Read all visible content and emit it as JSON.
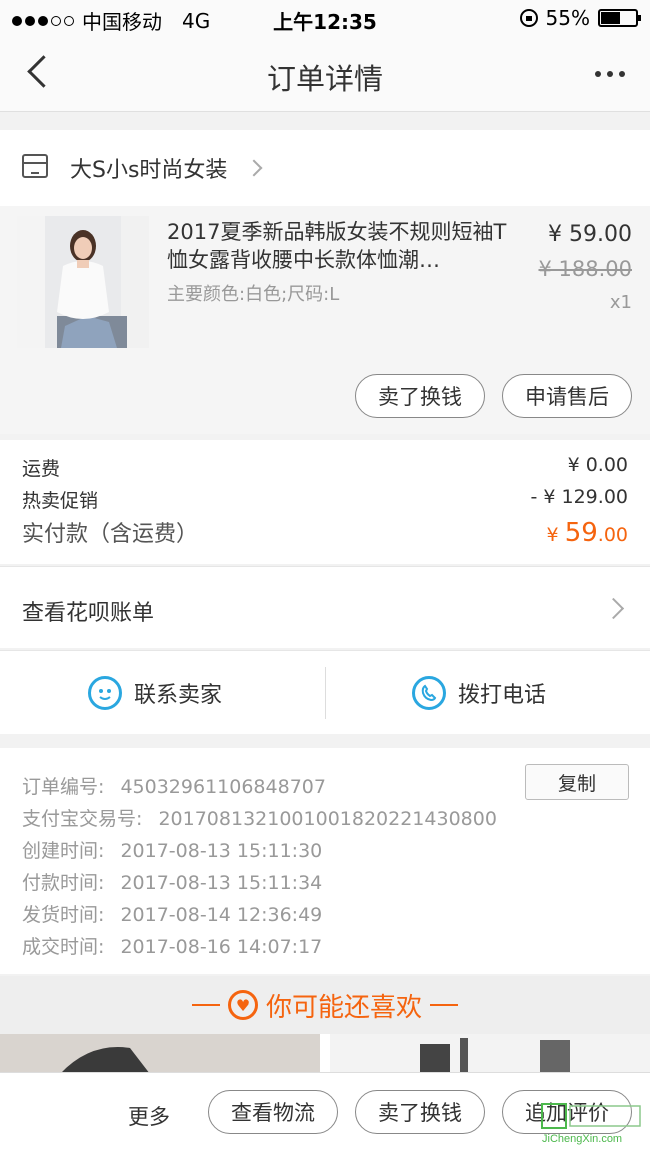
{
  "status_bar": {
    "carrier": "中国移动",
    "network": "4G",
    "time": "上午12:35",
    "battery_percent": "55%",
    "battery_level": 0.55
  },
  "nav": {
    "title": "订单详情",
    "back_icon": "chevron-left-icon",
    "more_icon": "ellipsis-icon"
  },
  "shop": {
    "name": "大S小s时尚女装",
    "icon": "store-icon"
  },
  "product": {
    "title": "2017夏季新品韩版女装不规则短袖T恤女露背收腰中长款体恤潮…",
    "spec": "主要颜色:白色;尺码:L",
    "price": "¥ 59.00",
    "original_price": "¥ 188.00",
    "quantity": "x1",
    "buttons": {
      "sell": "卖了换钱",
      "aftersale": "申请售后"
    }
  },
  "fees": {
    "shipping_label": "运费",
    "shipping_value": "¥ 0.00",
    "promo_label": "热卖促销",
    "promo_value": "- ¥ 129.00",
    "total_label": "实付款（含运费）",
    "total_currency": "¥",
    "total_int": "59",
    "total_dec": ".00"
  },
  "huabei": {
    "label": "查看花呗账单"
  },
  "contact": {
    "seller": "联系卖家",
    "phone": "拨打电话"
  },
  "order_info": {
    "copy_button": "复制",
    "rows": [
      {
        "label": "订单编号:",
        "value": "45032961106848707"
      },
      {
        "label": "支付宝交易号:",
        "value": "2017081321001001820221430800"
      },
      {
        "label": "创建时间:",
        "value": "2017-08-13 15:11:30"
      },
      {
        "label": "付款时间:",
        "value": "2017-08-13 15:11:34"
      },
      {
        "label": "发货时间:",
        "value": "2017-08-14 12:36:49"
      },
      {
        "label": "成交时间:",
        "value": "2017-08-16 14:07:17"
      }
    ]
  },
  "recommend": {
    "title": "你可能还喜欢"
  },
  "bottom": {
    "more": "更多",
    "logistics": "查看物流",
    "sell": "卖了换钱",
    "review": "追加评价"
  },
  "watermark": {
    "text": "JiChengXin.com"
  },
  "colors": {
    "accent": "#f5640f",
    "icon_blue": "#2aa7e0"
  }
}
